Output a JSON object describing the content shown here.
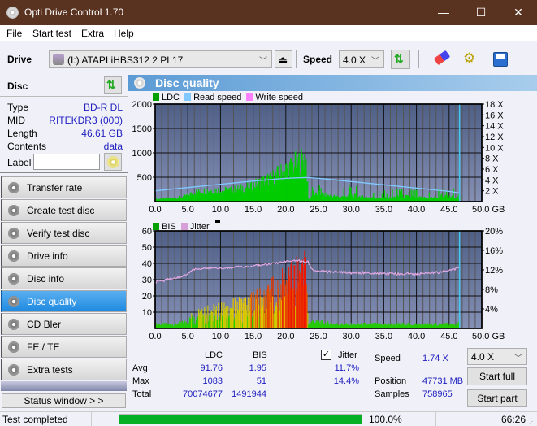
{
  "window": {
    "title": "Opti Drive Control 1.70",
    "minimize": "—",
    "maximize": "☐",
    "close": "✕"
  },
  "menu": [
    "File",
    "Start test",
    "Extra",
    "Help"
  ],
  "toolbar": {
    "drive_label": "Drive",
    "drive_value": "(I:)  ATAPI iHBS312   2 PL17",
    "speed_label": "Speed",
    "speed_value": "4.0 X"
  },
  "disc": {
    "header": "Disc",
    "type_label": "Type",
    "type": "BD-R DL",
    "mid_label": "MID",
    "mid": "RITEKDR3 (000)",
    "length_label": "Length",
    "length": "46.61 GB",
    "contents_label": "Contents",
    "contents": "data",
    "label_label": "Label",
    "label_value": ""
  },
  "nav": [
    {
      "label": "Transfer rate",
      "active": false
    },
    {
      "label": "Create test disc",
      "active": false
    },
    {
      "label": "Verify test disc",
      "active": false
    },
    {
      "label": "Drive info",
      "active": false
    },
    {
      "label": "Disc info",
      "active": false
    },
    {
      "label": "Disc quality",
      "active": true
    },
    {
      "label": "CD Bler",
      "active": false
    },
    {
      "label": "FE / TE",
      "active": false
    },
    {
      "label": "Extra tests",
      "active": false
    }
  ],
  "status_window": "Status window > >",
  "panel": {
    "title": "Disc quality"
  },
  "chart_data": [
    {
      "type": "area",
      "title": "LDC chart",
      "legend": [
        "LDC",
        "Read speed",
        "Write speed"
      ],
      "legend_colors": {
        "LDC": "#00a000",
        "Read speed": "#80c8ff",
        "Write speed": "#ff80ff"
      },
      "xlabel": "GB",
      "xlim": [
        0,
        50
      ],
      "x_ticks": [
        "0.0",
        "5.0",
        "10.0",
        "15.0",
        "20.0",
        "25.0",
        "30.0",
        "35.0",
        "40.0",
        "45.0",
        "50.0 GB"
      ],
      "ylim": [
        0,
        2000
      ],
      "y_ticks": [
        "500",
        "1000",
        "1500",
        "2000"
      ],
      "y2lim": [
        0,
        18
      ],
      "y2_ticks": [
        "2 X",
        "4 X",
        "6 X",
        "8 X",
        "10 X",
        "12 X",
        "14 X",
        "16 X",
        "18 X"
      ],
      "ldc_x": [
        0,
        1,
        2,
        3,
        4,
        5,
        6,
        7,
        8,
        9,
        10,
        11,
        12,
        13,
        14,
        15,
        16,
        17,
        18,
        19,
        20,
        21,
        22,
        23,
        23.4,
        24,
        25,
        26,
        28,
        30,
        32,
        34,
        36,
        38,
        40,
        42,
        44,
        46,
        46.6
      ],
      "ldc_y": [
        60,
        70,
        80,
        90,
        110,
        160,
        230,
        260,
        270,
        280,
        280,
        270,
        290,
        320,
        350,
        400,
        470,
        520,
        590,
        680,
        780,
        870,
        960,
        1070,
        60,
        150,
        200,
        160,
        120,
        150,
        110,
        90,
        100,
        130,
        100,
        90,
        120,
        110,
        140
      ],
      "read_speed_x": [
        0,
        5,
        10,
        15,
        20,
        23.4,
        25,
        30,
        35,
        40,
        45,
        46.6
      ],
      "read_speed_y": [
        2.0,
        2.6,
        3.2,
        3.8,
        4.3,
        4.45,
        4.3,
        3.7,
        3.1,
        2.5,
        1.9,
        1.6
      ],
      "end_marker_gb": 46.6
    },
    {
      "type": "area",
      "title": "BIS / Jitter chart",
      "legend": [
        "BIS",
        "Jitter"
      ],
      "legend_colors": {
        "BIS": "#00a000",
        "Jitter": "#d8a0d8"
      },
      "xlabel": "GB",
      "xlim": [
        0,
        50
      ],
      "x_ticks": [
        "0.0",
        "5.0",
        "10.0",
        "15.0",
        "20.0",
        "25.0",
        "30.0",
        "35.0",
        "40.0",
        "45.0",
        "50.0 GB"
      ],
      "ylim": [
        0,
        60
      ],
      "y_ticks": [
        "10",
        "20",
        "30",
        "40",
        "50",
        "60"
      ],
      "y2lim": [
        0,
        20
      ],
      "y2_ticks": [
        "4%",
        "8%",
        "12%",
        "16%",
        "20%"
      ],
      "bis_x": [
        0,
        1,
        2,
        3,
        4,
        5,
        6,
        7,
        8,
        9,
        10,
        11,
        12,
        13,
        14,
        15,
        16,
        17,
        18,
        19,
        20,
        21,
        22,
        22.5,
        23,
        23.4,
        24,
        26,
        28,
        30,
        32,
        34,
        36,
        38,
        40,
        42,
        44,
        46,
        46.6
      ],
      "bis_y": [
        3,
        3,
        3,
        3,
        4,
        5,
        12,
        14,
        14,
        13,
        14,
        14,
        16,
        17,
        18,
        20,
        22,
        24,
        27,
        30,
        33,
        36,
        38,
        50,
        40,
        3,
        5,
        4,
        3,
        3,
        3,
        3,
        3,
        3,
        3,
        3,
        3,
        3,
        4
      ],
      "jitter_x": [
        0,
        2,
        4,
        5,
        6,
        8,
        10,
        12,
        14,
        16,
        18,
        20,
        22,
        23.4,
        24,
        26,
        28,
        30,
        32,
        34,
        36,
        38,
        40,
        42,
        44,
        46,
        46.6
      ],
      "jitter_y": [
        9.5,
        10.0,
        10.6,
        11.2,
        12.2,
        12.3,
        12.4,
        12.5,
        12.7,
        12.9,
        13.3,
        13.6,
        13.9,
        13.6,
        12.0,
        11.7,
        11.5,
        11.4,
        11.4,
        11.3,
        11.2,
        11.2,
        11.2,
        11.3,
        11.6,
        12.2,
        12.5
      ],
      "end_marker_gb": 46.6
    }
  ],
  "stats": {
    "col_ldc": "LDC",
    "col_bis": "BIS",
    "jitter_label": "Jitter",
    "jitter_checked": true,
    "rows": [
      {
        "label": "Avg",
        "ldc": "91.76",
        "bis": "1.95",
        "jitter": "11.7%"
      },
      {
        "label": "Max",
        "ldc": "1083",
        "bis": "51",
        "jitter": "14.4%"
      },
      {
        "label": "Total",
        "ldc": "70074677",
        "bis": "1491944",
        "jitter": ""
      }
    ],
    "speed_label": "Speed",
    "speed_value": "1.74 X",
    "position_label": "Position",
    "position_value": "47731 MB",
    "samples_label": "Samples",
    "samples_value": "758965",
    "speed_select": "4.0 X",
    "start_full": "Start full",
    "start_part": "Start part"
  },
  "statusbar": {
    "text": "Test completed",
    "progress": 1.0,
    "progress_text": "100.0%",
    "time": "66:26"
  }
}
